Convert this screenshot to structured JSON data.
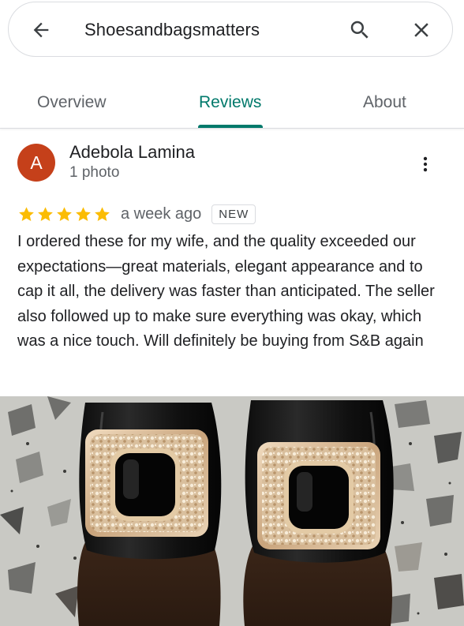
{
  "search": {
    "query": "Shoesandbagsmatters",
    "back_icon": "arrow-left-icon",
    "search_icon": "search-icon",
    "close_icon": "close-icon"
  },
  "tabs": [
    {
      "label": "Overview",
      "active": false
    },
    {
      "label": "Reviews",
      "active": true
    },
    {
      "label": "About",
      "active": false
    }
  ],
  "colors": {
    "accent": "#00796b",
    "avatar_bg": "#c5401a",
    "star": "#fbbc04"
  },
  "review": {
    "author": {
      "name": "Adebola Lamina",
      "initial": "A",
      "meta": "1 photo"
    },
    "rating": 5,
    "rating_max": 5,
    "time": "a week ago",
    "badge": "NEW",
    "text": "I ordered these for my wife, and the quality exceeded our expectations—great materials, elegant appearance and to cap it all, the delivery was faster than anticipated. The seller also followed up to make sure everything was okay, which was a nice touch. Will definitely be buying from S&B again",
    "more_icon": "more-vert-icon"
  }
}
